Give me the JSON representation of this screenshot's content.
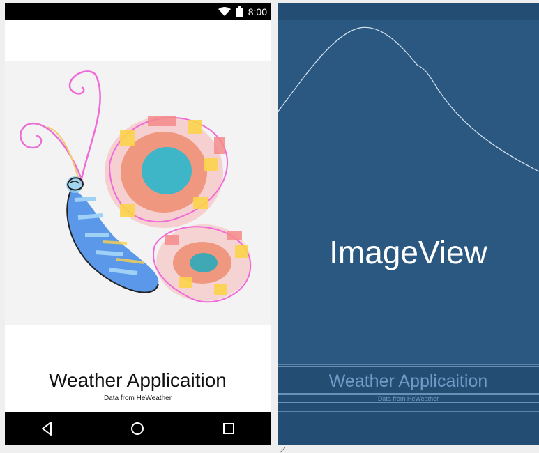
{
  "status_bar": {
    "time": "8:00"
  },
  "design_preview": {
    "title": "Weather Applicaition",
    "subtitle": "Data from HeWeather",
    "image": "butterfly-drawing"
  },
  "blueprint": {
    "image_label": "ImageView",
    "title": "Weather Applicaition",
    "subtitle": "Data from HeWeather"
  },
  "navigation": [
    "back-icon",
    "home-icon",
    "recents-icon"
  ],
  "colors": {
    "status_bar": "#000000",
    "blueprint_bg": "#234d72",
    "blueprint_text": "#6f9bc6"
  }
}
